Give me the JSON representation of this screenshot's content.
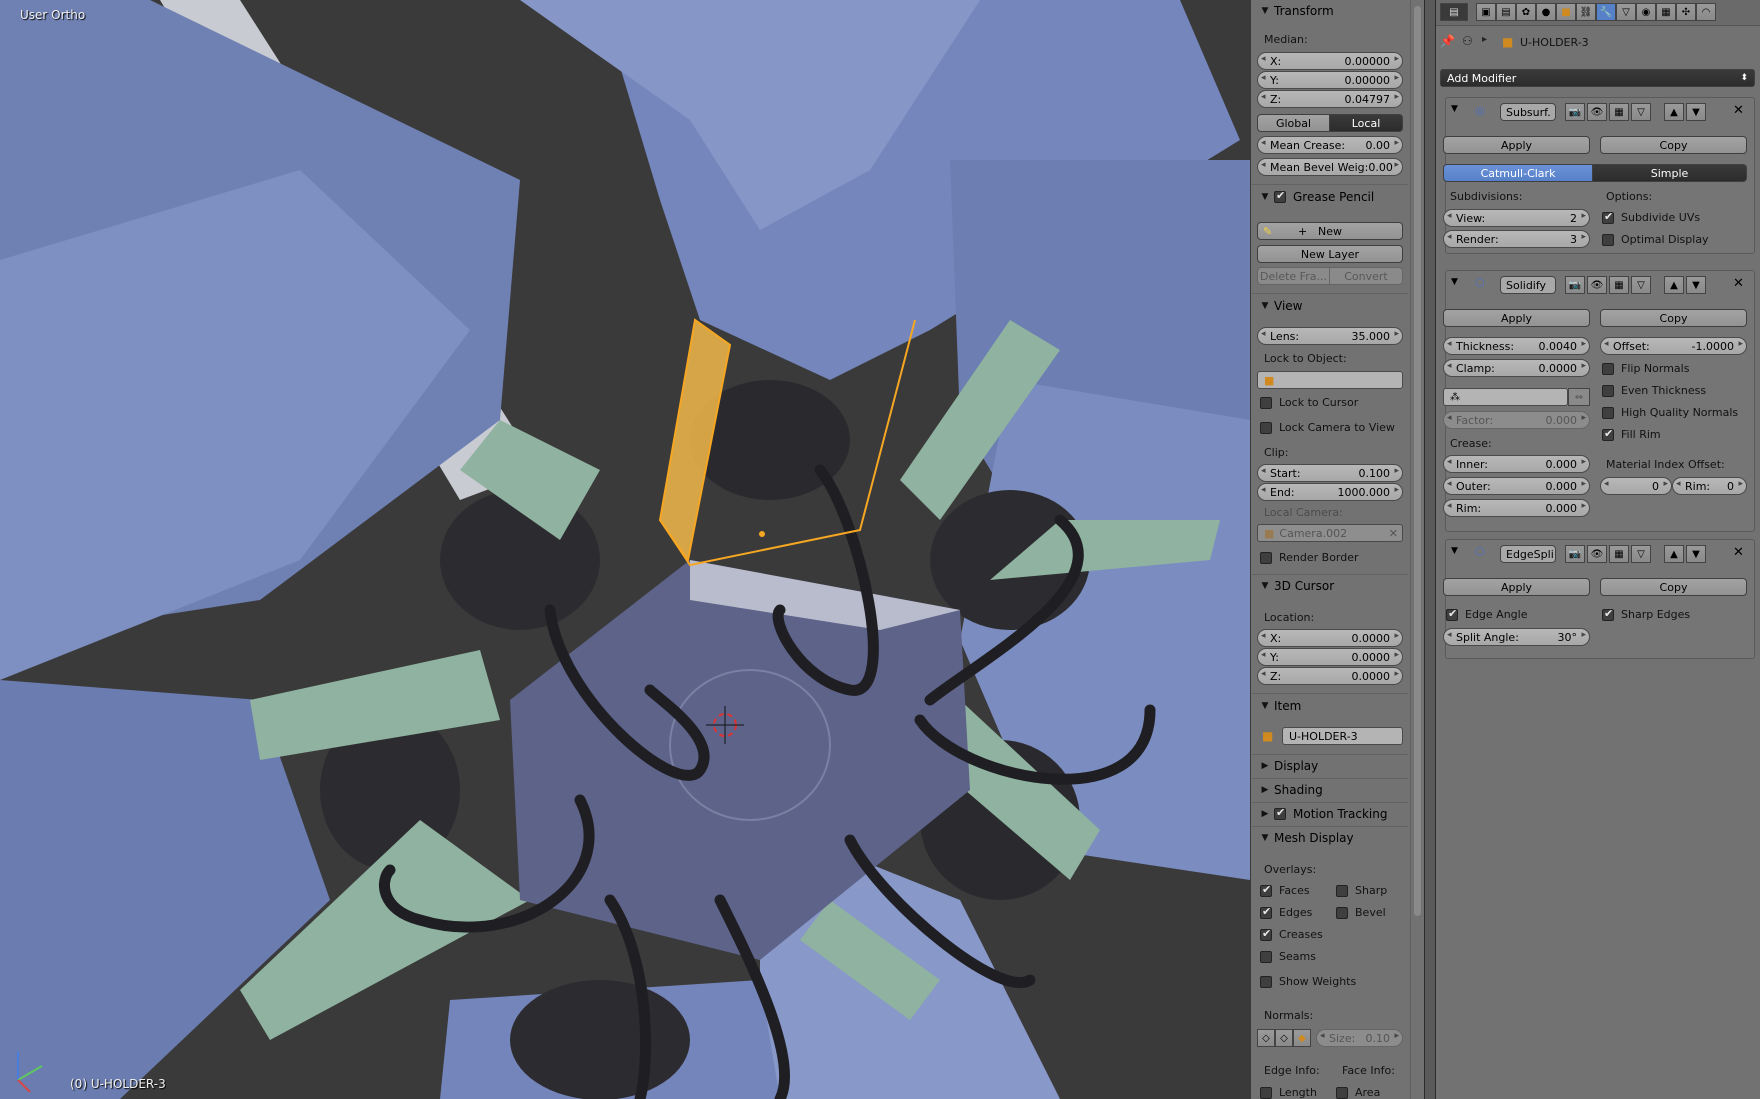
{
  "viewport": {
    "view_label": "User Ortho",
    "object_label": "(0) U-HOLDER-3"
  },
  "npanel": {
    "transform": {
      "title": "Transform",
      "median_label": "Median:",
      "x": {
        "label": "X:",
        "value": "0.00000"
      },
      "y": {
        "label": "Y:",
        "value": "0.00000"
      },
      "z": {
        "label": "Z:",
        "value": "0.04797"
      },
      "global_label": "Global",
      "local_label": "Local",
      "mean_crease": {
        "label": "Mean Crease:",
        "value": "0.00"
      },
      "mean_bevel": {
        "label": "Mean Bevel Weig:",
        "value": "0.00"
      }
    },
    "grease_pencil": {
      "title": "Grease Pencil",
      "new_label": "New",
      "new_layer_label": "New Layer",
      "delete_frame_label": "Delete Fra...",
      "convert_label": "Convert"
    },
    "view": {
      "title": "View",
      "lens": {
        "label": "Lens:",
        "value": "35.000"
      },
      "lock_to_object_label": "Lock to Object:",
      "lock_to_cursor_label": "Lock to Cursor",
      "lock_camera_label": "Lock Camera to View",
      "clip_label": "Clip:",
      "start": {
        "label": "Start:",
        "value": "0.100"
      },
      "end": {
        "label": "End:",
        "value": "1000.000"
      },
      "local_camera_label": "Local Camera:",
      "local_camera_value": "Camera.002",
      "render_border_label": "Render Border"
    },
    "cursor": {
      "title": "3D Cursor",
      "location_label": "Location:",
      "x": {
        "label": "X:",
        "value": "0.0000"
      },
      "y": {
        "label": "Y:",
        "value": "0.0000"
      },
      "z": {
        "label": "Z:",
        "value": "0.0000"
      }
    },
    "item": {
      "title": "Item",
      "name": "U-HOLDER-3"
    },
    "display_title": "Display",
    "shading_title": "Shading",
    "motion_tracking_title": "Motion Tracking",
    "mesh_display": {
      "title": "Mesh Display",
      "overlays_label": "Overlays:",
      "faces_label": "Faces",
      "sharp_label": "Sharp",
      "edges_label": "Edges",
      "bevel_label": "Bevel",
      "creases_label": "Creases",
      "seams_label": "Seams",
      "show_weights_label": "Show Weights",
      "normals_label": "Normals:",
      "size": {
        "label": "Size:",
        "value": "0.10"
      },
      "edge_info_label": "Edge Info:",
      "face_info_label": "Face Info:",
      "length_label": "Length",
      "area_label": "Area"
    }
  },
  "properties": {
    "object_name": "U-HOLDER-3",
    "add_modifier_label": "Add Modifier",
    "subsurf": {
      "name": "Subsurf.",
      "apply_label": "Apply",
      "copy_label": "Copy",
      "catmull_label": "Catmull-Clark",
      "simple_label": "Simple",
      "subdivisions_label": "Subdivisions:",
      "options_label": "Options:",
      "view": {
        "label": "View:",
        "value": "2"
      },
      "render": {
        "label": "Render:",
        "value": "3"
      },
      "subdivide_uvs_label": "Subdivide UVs",
      "optimal_display_label": "Optimal Display"
    },
    "solidify": {
      "name": "Solidify",
      "apply_label": "Apply",
      "copy_label": "Copy",
      "thickness": {
        "label": "Thickness:",
        "value": "0.0040"
      },
      "offset": {
        "label": "Offset:",
        "value": "-1.0000"
      },
      "clamp": {
        "label": "Clamp:",
        "value": "0.0000"
      },
      "flip_normals_label": "Flip Normals",
      "even_thickness_label": "Even Thickness",
      "high_quality_label": "High Quality Normals",
      "fill_rim_label": "Fill Rim",
      "factor": {
        "label": "Factor:",
        "value": "0.000"
      },
      "crease_label": "Crease:",
      "inner": {
        "label": "Inner:",
        "value": "0.000"
      },
      "outer": {
        "label": "Outer:",
        "value": "0.000"
      },
      "rim": {
        "label": "Rim:",
        "value": "0.000"
      },
      "material_index_label": "Material Index Offset:",
      "mat_offset_value": "0",
      "mat_rim": {
        "label": "Rim:",
        "value": "0"
      }
    },
    "edgesplit": {
      "name": "EdgeSpli",
      "apply_label": "Apply",
      "copy_label": "Copy",
      "edge_angle_label": "Edge Angle",
      "sharp_edges_label": "Sharp Edges",
      "split_angle": {
        "label": "Split Angle:",
        "value": "30°"
      }
    }
  },
  "colors": {
    "selected_outline": "#f5a623",
    "active_button": "#5680c8",
    "panel_bg": "#727272"
  }
}
